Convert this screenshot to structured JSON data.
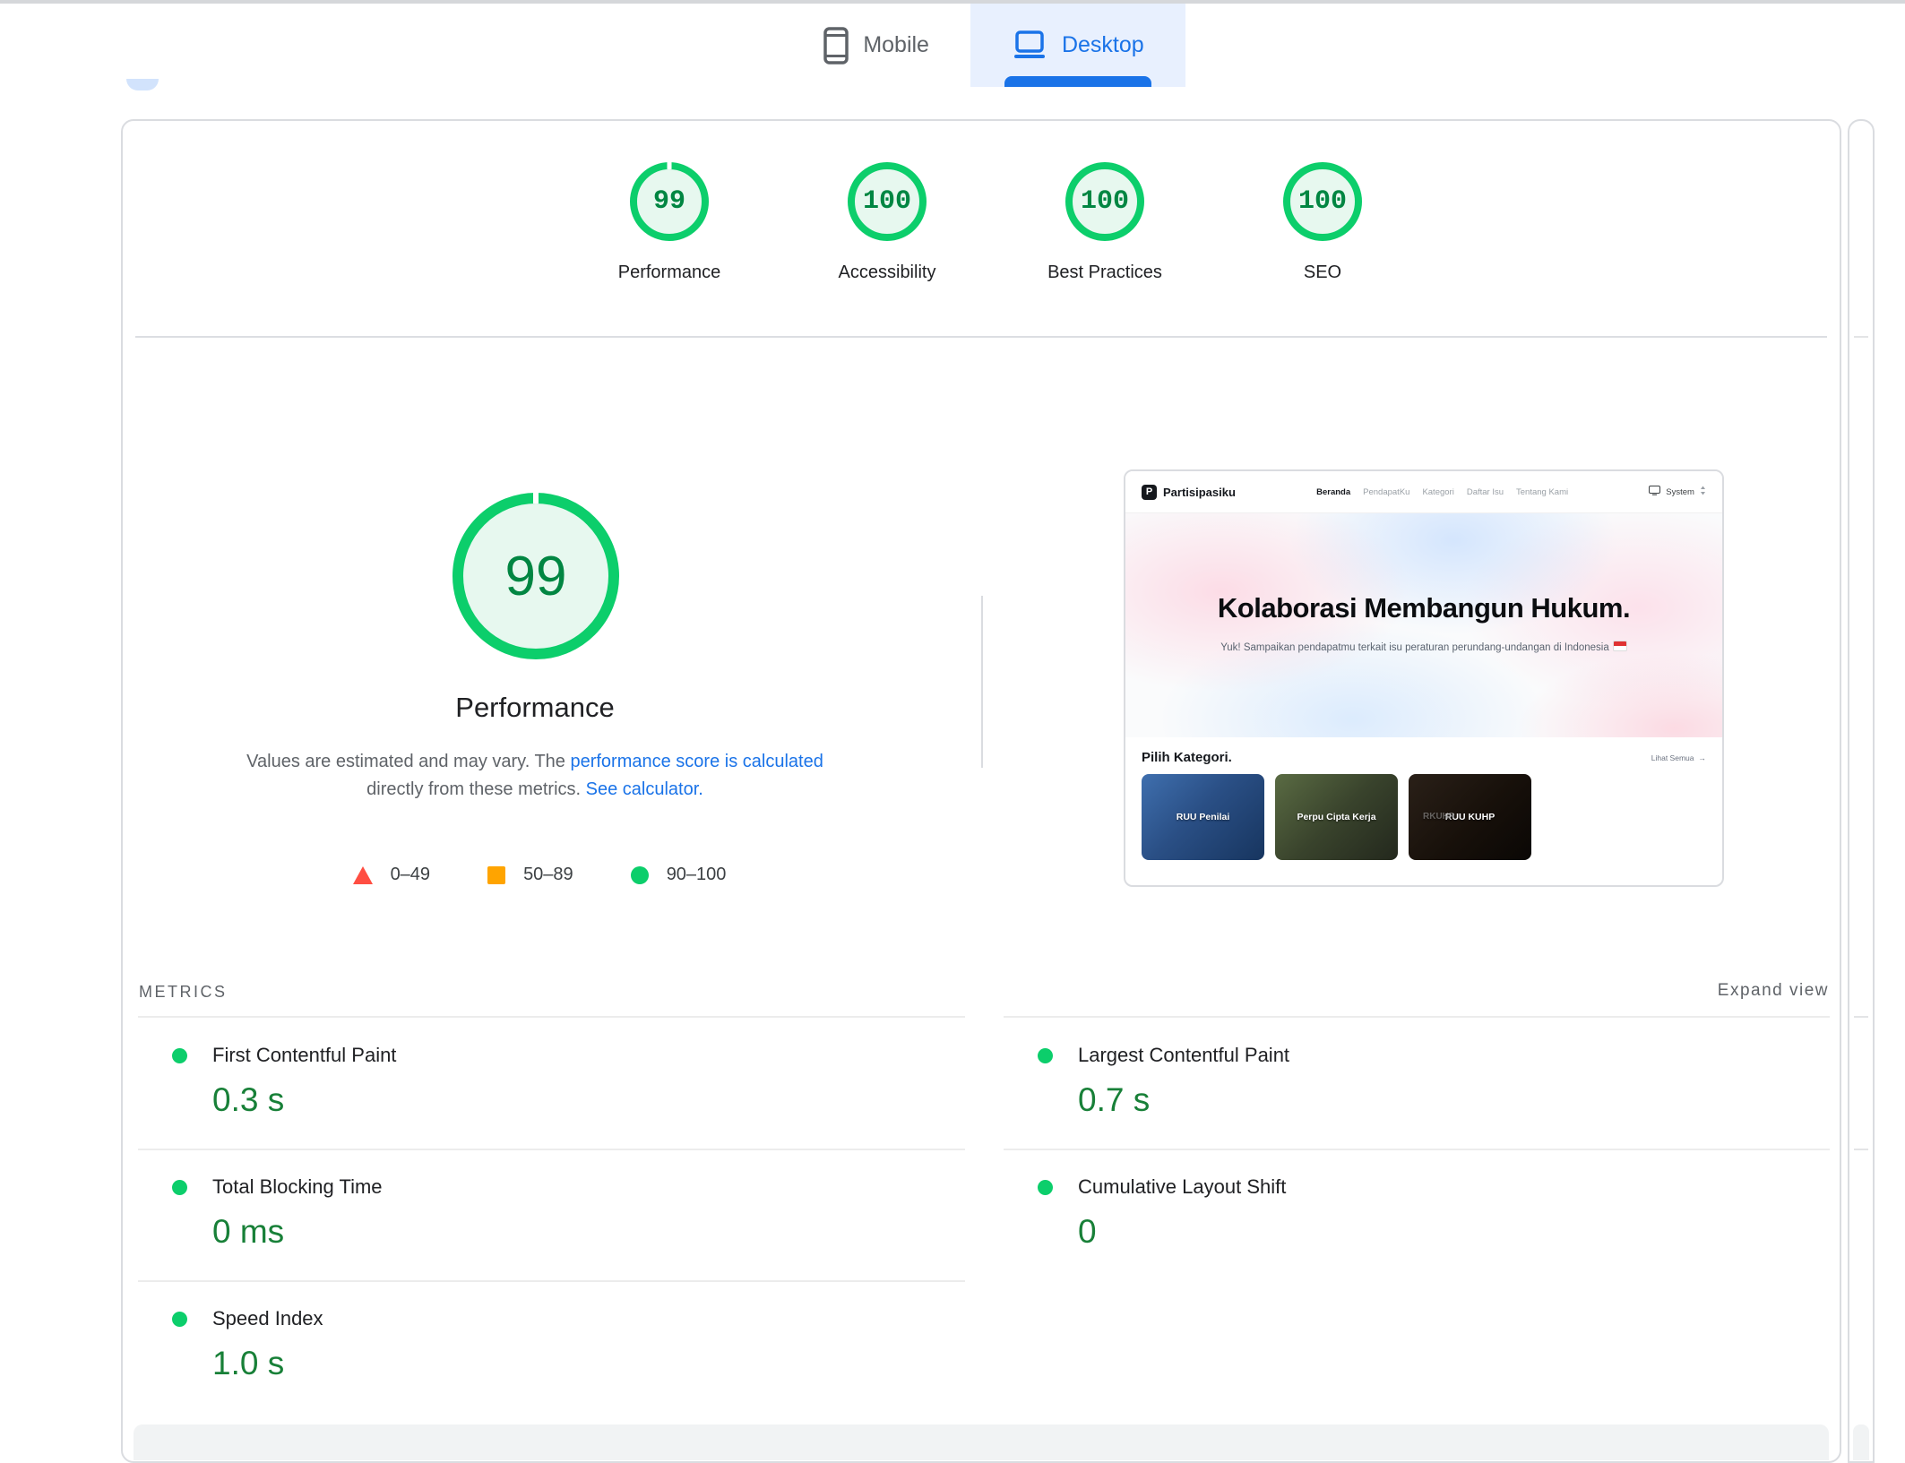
{
  "tabs": {
    "mobile": "Mobile",
    "desktop": "Desktop"
  },
  "scores": [
    {
      "label": "Performance",
      "value": "99"
    },
    {
      "label": "Accessibility",
      "value": "100"
    },
    {
      "label": "Best Practices",
      "value": "100"
    },
    {
      "label": "SEO",
      "value": "100"
    }
  ],
  "gauge": {
    "value": "99",
    "label": "Performance"
  },
  "description": {
    "line1_text": "Values are estimated and may vary. The ",
    "line1_link": "performance score is calculated",
    "line2_text": "directly from these metrics. ",
    "line2_link": "See calculator."
  },
  "legend": [
    {
      "range": "0–49"
    },
    {
      "range": "50–89"
    },
    {
      "range": "90–100"
    }
  ],
  "metrics_section": {
    "title": "METRICS",
    "expand": "Expand view"
  },
  "metrics": {
    "left": [
      {
        "name": "First Contentful Paint",
        "value": "0.3 s"
      },
      {
        "name": "Total Blocking Time",
        "value": "0 ms"
      },
      {
        "name": "Speed Index",
        "value": "1.0 s"
      }
    ],
    "right": [
      {
        "name": "Largest Contentful Paint",
        "value": "0.7 s"
      },
      {
        "name": "Cumulative Layout Shift",
        "value": "0"
      }
    ]
  },
  "thumbnail": {
    "logo_letter": "P",
    "brand": "Partisipasiku",
    "nav": [
      "Beranda",
      "PendapatKu",
      "Kategori",
      "Daftar Isu",
      "Tentang Kami"
    ],
    "theme": "System",
    "hero_title": "Kolaborasi Membangun Hukum.",
    "hero_subtitle": "Yuk! Sampaikan pendapatmu terkait isu peraturan perundang-undangan di Indonesia",
    "section_title": "Pilih Kategori.",
    "see_all": "Lihat Semua",
    "see_all_arrow": "→",
    "cards": [
      {
        "label": "RUU Penilai"
      },
      {
        "label": "Perpu Cipta Kerja"
      },
      {
        "label": "RUU KUHP",
        "ghost": "RKUHP"
      }
    ]
  },
  "colors": {
    "pass_ring": "#0cce6b",
    "pass_text": "#018642",
    "metric_value_green": "#188038",
    "link_blue": "#1a73e8",
    "tab_selected_bg": "#e8f0fe",
    "legend_fail": "#ff4e42",
    "legend_average": "#ffa400",
    "legend_pass": "#0cce6b"
  }
}
